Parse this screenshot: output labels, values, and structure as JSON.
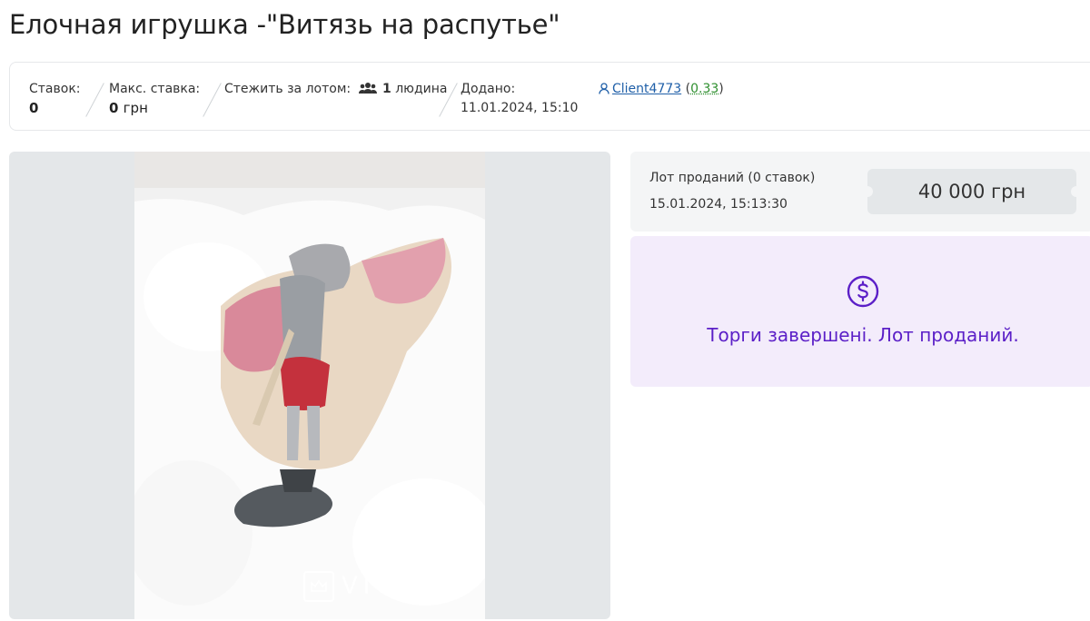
{
  "page": {
    "title": "Елочная игрушка -\"Витязь на распутье\""
  },
  "info": {
    "bids_label": "Ставок:",
    "bids_value": "0",
    "max_bid_label": "Макс. ставка:",
    "max_bid_value": "0",
    "max_bid_unit": "грн",
    "watch_label": "Стежить за лотом:",
    "watch_count": "1",
    "watch_unit": "людина",
    "added_label": "Додано:",
    "added_value": "11.01.2024, 15:10",
    "seller_name": "Client4773",
    "seller_rating_open": "(",
    "seller_rating": "0.33",
    "seller_rating_close": ")"
  },
  "gallery": {
    "watermark": "VIOLITY"
  },
  "status": {
    "sold_text": "Лот проданий (0 ставок)",
    "sold_date": "15.01.2024, 15:13:30",
    "price": "40 000 грн"
  },
  "ended": {
    "message": "Торги завершені. Лот проданий."
  },
  "colors": {
    "accent": "#5b1fc7",
    "link": "#1f5fa8",
    "rating": "#2f8f2f"
  }
}
